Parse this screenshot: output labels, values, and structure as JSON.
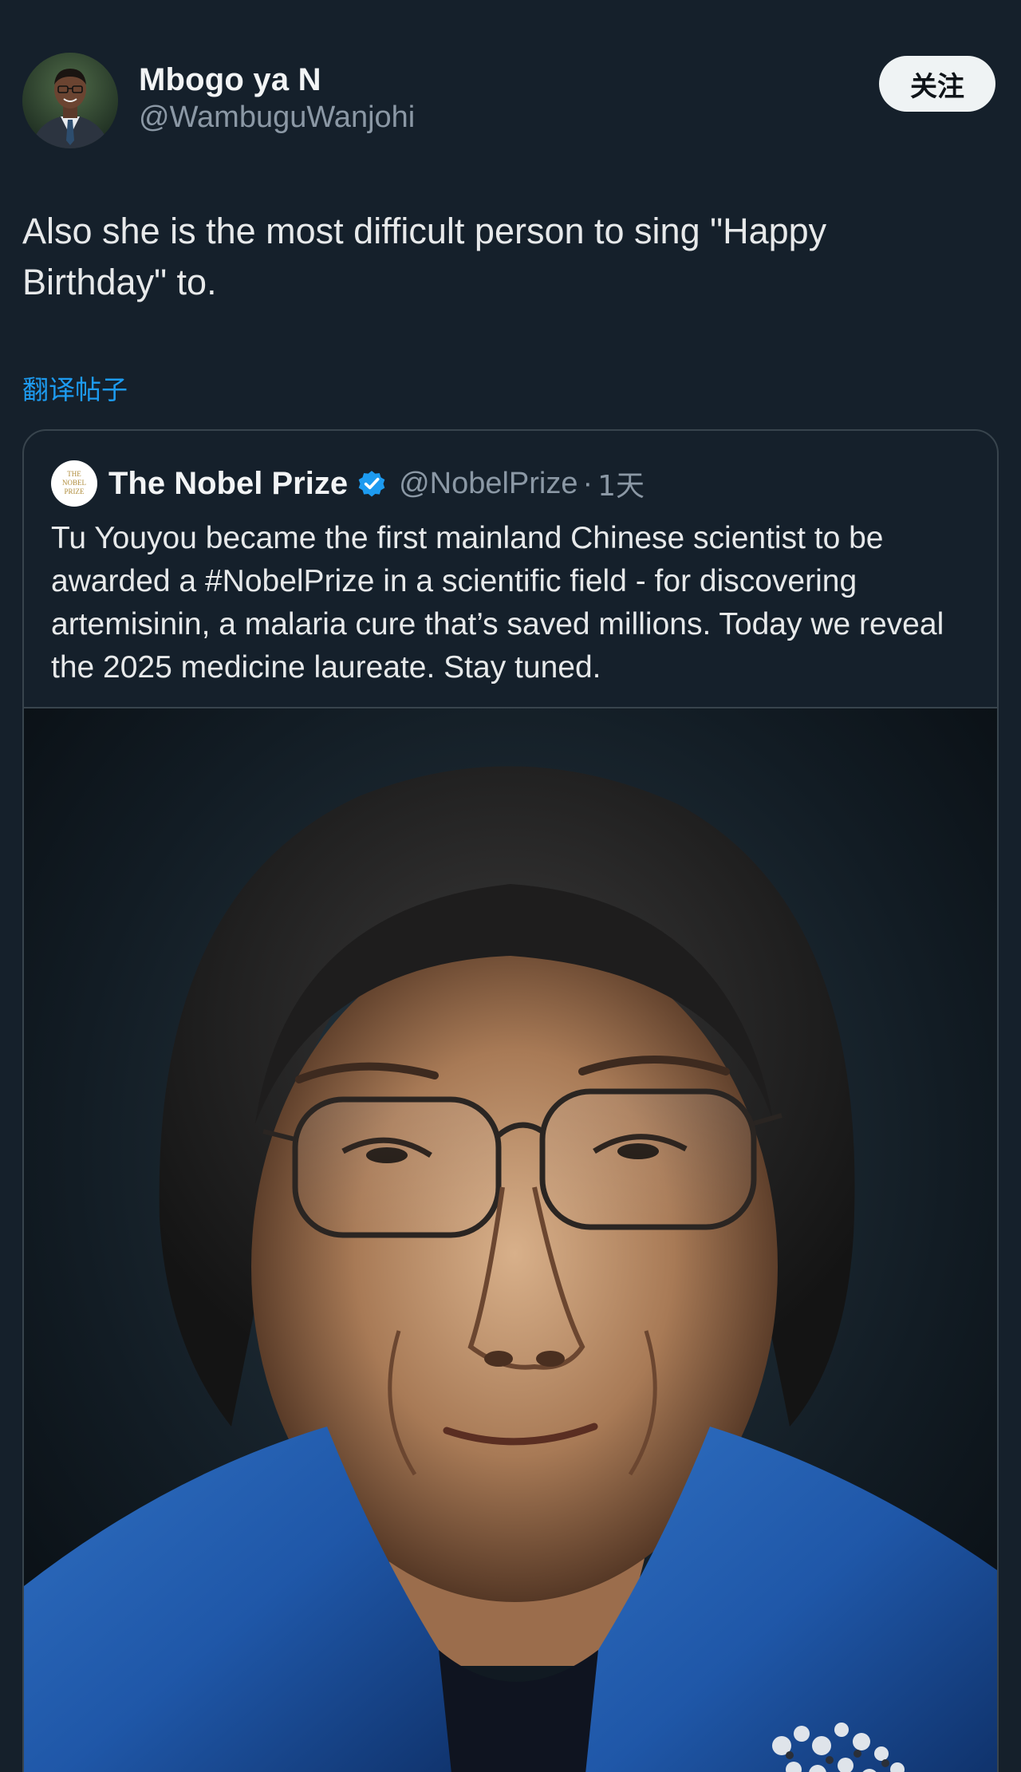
{
  "author": {
    "display_name": "Mbogo ya N",
    "handle": "@WambuguWanjohi",
    "avatar_icon": "person-avatar-icon"
  },
  "follow_button": {
    "label": "关注"
  },
  "post": {
    "text": "Also she is the most difficult person to sing \"Happy Birthday\" to.",
    "translate_label": "翻译帖子"
  },
  "quoted_post": {
    "logo_icon": "nobel-prize-logo-icon",
    "logo_text": "THE NOBEL PRIZE",
    "display_name": "The Nobel Prize",
    "verified_icon": "verified-badge-icon",
    "handle": "@NobelPrize",
    "separator": "·",
    "time": "1天",
    "text": "Tu Youyou became the first mainland Chinese scientist to be awarded a #NobelPrize in a scientific field - for discovering artemisinin, a malaria cure that’s saved millions. Today we reveal the 2025 medicine laureate. Stay tuned.",
    "media": "portrait-photo"
  },
  "colors": {
    "background": "#15202b",
    "text_primary": "#e7e9ea",
    "text_secondary": "#8b98a5",
    "link": "#1d9bf0",
    "border": "#38444d",
    "follow_bg": "#eff3f4",
    "verified": "#1d9bf0"
  }
}
